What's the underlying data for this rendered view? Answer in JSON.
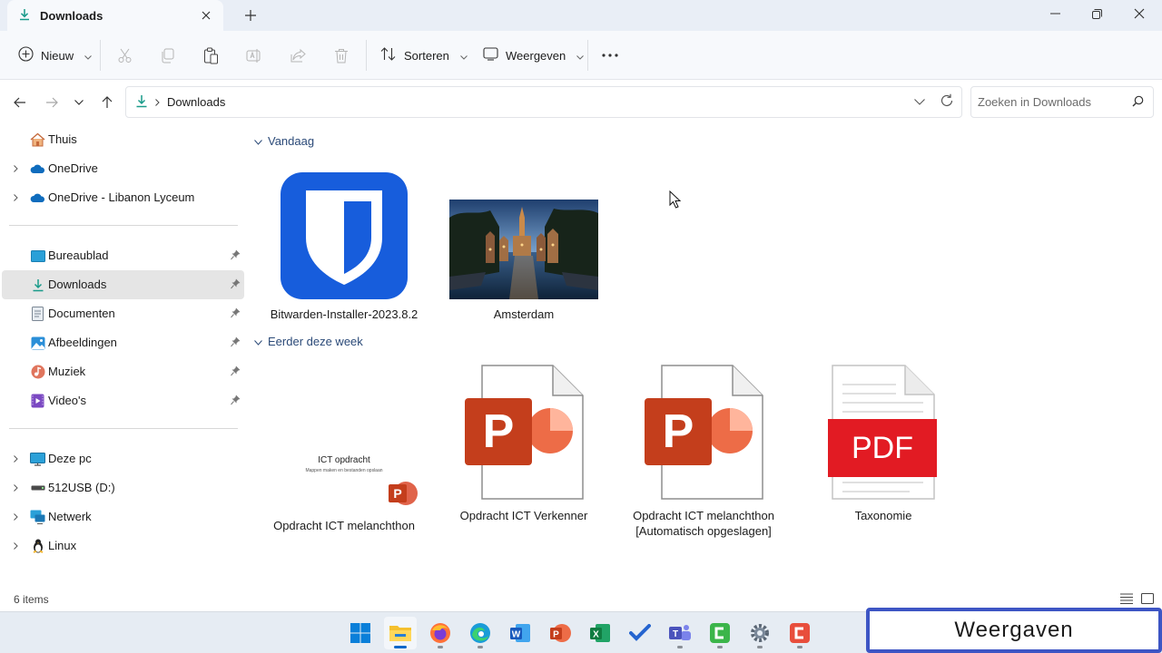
{
  "window": {
    "tab_title": "Downloads",
    "controls": [
      "minimize",
      "maximize",
      "close"
    ]
  },
  "toolbar": {
    "new_label": "Nieuw",
    "sort_label": "Sorteren",
    "view_label": "Weergeven",
    "icons": [
      "cut-icon",
      "copy-icon",
      "paste-icon",
      "rename-icon",
      "share-icon",
      "delete-icon",
      "more-icon"
    ]
  },
  "address": {
    "breadcrumb": "Downloads",
    "search_placeholder": "Zoeken in Downloads"
  },
  "sidebar": {
    "items": [
      {
        "label": "Thuis",
        "icon": "home-icon"
      },
      {
        "label": "OneDrive",
        "icon": "cloud-icon"
      },
      {
        "label": "OneDrive - Libanon Lyceum",
        "icon": "cloud-icon"
      },
      {
        "label": "Bureaublad",
        "icon": "desktop-icon"
      },
      {
        "label": "Downloads",
        "icon": "download-icon"
      },
      {
        "label": "Documenten",
        "icon": "document-icon"
      },
      {
        "label": "Afbeeldingen",
        "icon": "pictures-icon"
      },
      {
        "label": "Muziek",
        "icon": "music-icon"
      },
      {
        "label": "Video's",
        "icon": "video-icon"
      },
      {
        "label": "Deze pc",
        "icon": "pc-icon"
      },
      {
        "label": "512USB (D:)",
        "icon": "usb-drive-icon"
      },
      {
        "label": "Netwerk",
        "icon": "network-icon"
      },
      {
        "label": "Linux",
        "icon": "linux-icon"
      }
    ]
  },
  "content": {
    "groups": [
      {
        "header": "Vandaag",
        "files": [
          {
            "name": "Bitwarden-Installer-2023.8.2"
          },
          {
            "name": "Amsterdam"
          }
        ]
      },
      {
        "header": "Eerder deze week",
        "files": [
          {
            "name": "Opdracht ICT melanchthon",
            "preview_title": "ICT opdracht",
            "preview_subtitle": "Mappen maken en bestanden opslaan"
          },
          {
            "name": "Opdracht ICT Verkenner"
          },
          {
            "name": "Opdracht ICT melanchthon [Automatisch opgeslagen]"
          },
          {
            "name": "Taxonomie",
            "badge": "PDF"
          }
        ]
      }
    ]
  },
  "status": {
    "item_count": "6 items"
  },
  "taskbar": {
    "apps": [
      "start-icon",
      "file-explorer-icon",
      "firefox-icon",
      "edge-icon",
      "word-icon",
      "powerpoint-icon",
      "excel-icon",
      "todo-icon",
      "teams-icon",
      "camtasia-icon",
      "settings-icon",
      "camtasia-recorder-icon"
    ]
  },
  "caption": {
    "text": "Weergaven"
  },
  "colors": {
    "accent": "#0b67c9",
    "powerpoint": "#c43e1c",
    "pdf": "#e21b23",
    "bitwarden": "#175ddc"
  }
}
